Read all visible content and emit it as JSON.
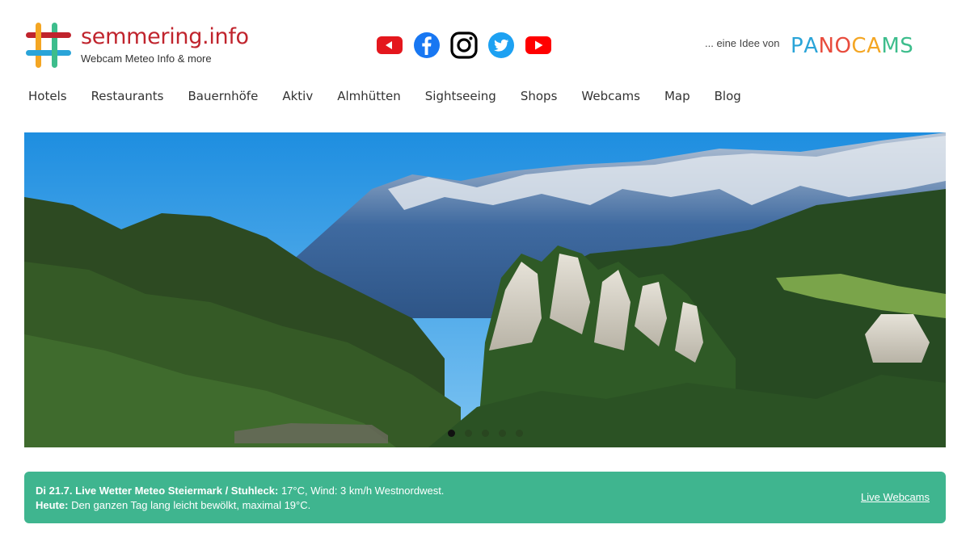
{
  "brand": {
    "title": "semmering.info",
    "subtitle": "Webcam Meteo Info & more"
  },
  "social": [
    {
      "name": "youtube-alt-icon",
      "color": "#e4171d"
    },
    {
      "name": "facebook-icon",
      "color": "#1877f2"
    },
    {
      "name": "instagram-icon",
      "color": "#000000"
    },
    {
      "name": "twitter-icon",
      "color": "#1da1f2"
    },
    {
      "name": "youtube-icon",
      "color": "#ff0000"
    }
  ],
  "partner": {
    "prefix": "... eine Idee von",
    "logo_letters": [
      {
        "ch": "P",
        "color": "#2aa4d8"
      },
      {
        "ch": "A",
        "color": "#2aa4d8"
      },
      {
        "ch": "N",
        "color": "#e84c3d"
      },
      {
        "ch": "O",
        "color": "#e84c3d"
      },
      {
        "ch": "C",
        "color": "#f4a623"
      },
      {
        "ch": "A",
        "color": "#f4a623"
      },
      {
        "ch": "M",
        "color": "#3dbd8c"
      },
      {
        "ch": "S",
        "color": "#3dbd8c"
      }
    ]
  },
  "nav": {
    "items": [
      "Hotels",
      "Restaurants",
      "Bauernhöfe",
      "Aktiv",
      "Almhütten",
      "Sightseeing",
      "Shops",
      "Webcams",
      "Map",
      "Blog"
    ]
  },
  "slider": {
    "slide_count": 5,
    "active_index": 0
  },
  "weather": {
    "line1_bold": "Di 21.7. Live Wetter Meteo Steiermark / Stuhleck:",
    "line1_text": " 17°C, Wind: 3 km/h Westnordwest.",
    "line2_bold": "Heute:",
    "line2_text": " Den ganzen Tag lang leicht bewölkt, maximal 19°C.",
    "link_label": "Live Webcams",
    "bg_color": "#3fb58f"
  }
}
